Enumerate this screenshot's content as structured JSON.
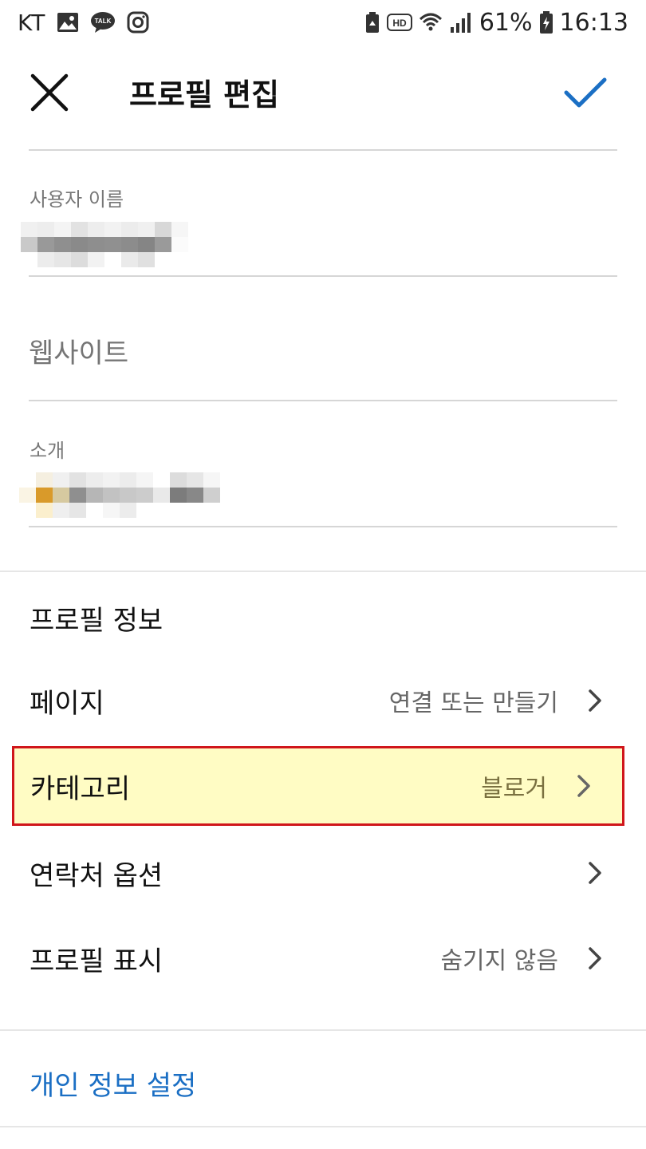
{
  "status_bar": {
    "carrier": "KT",
    "battery": "61%",
    "time": "16:13",
    "icons": [
      "gallery-icon",
      "kakaotalk-icon",
      "instagram-icon",
      "battery-saver-icon",
      "hd-voice-icon",
      "wifi-icon",
      "signal-icon",
      "battery-icon"
    ]
  },
  "toolbar": {
    "title": "프로필 편집",
    "close_icon": "close-icon",
    "done_icon": "check-icon",
    "accent_color": "#1b6fc4"
  },
  "fields": {
    "username": {
      "label": "사용자 이름",
      "value": ""
    },
    "website": {
      "placeholder": "웹사이트",
      "value": ""
    },
    "bio": {
      "label": "소개",
      "value": ""
    }
  },
  "profile_info": {
    "title": "프로필 정보",
    "rows": [
      {
        "label": "페이지",
        "value": "연결 또는 만들기"
      },
      {
        "label": "카테고리",
        "value": "블로거"
      },
      {
        "label": "연락처 옵션",
        "value": ""
      },
      {
        "label": "프로필 표시",
        "value": "숨기지 않음"
      }
    ]
  },
  "privacy": {
    "label": "개인 정보 설정"
  },
  "highlight": {
    "fill": "#fffcc4",
    "border": "#d0161b"
  }
}
